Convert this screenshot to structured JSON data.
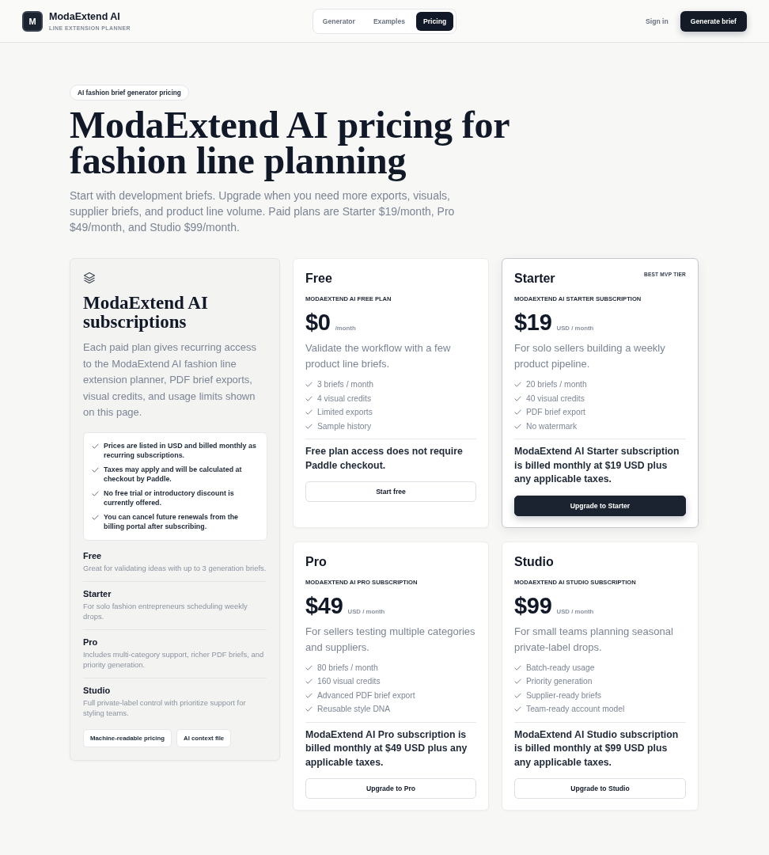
{
  "header": {
    "logo_letter": "M",
    "brand": "ModaExtend AI",
    "tagline": "LINE EXTENSION PLANNER",
    "nav": [
      {
        "label": "Generator",
        "selected": false
      },
      {
        "label": "Examples",
        "selected": false
      },
      {
        "label": "Pricing",
        "selected": true
      }
    ],
    "sign_in": "Sign in",
    "cta": "Generate brief"
  },
  "hero": {
    "badge": "AI fashion brief generator pricing",
    "title": "ModaExtend AI pricing for fashion line planning",
    "intro": "Start with development briefs. Upgrade when you need more exports, visuals, supplier briefs, and product line volume. Paid plans are Starter $19/month, Pro $49/month, and Studio $99/month."
  },
  "overview": {
    "heading": "ModaExtend AI subscriptions",
    "text": "Each paid plan gives recurring access to the ModaExtend AI fashion line extension planner, PDF brief exports, visual credits, and usage limits shown on this page.",
    "notes": [
      "Prices are listed in USD and billed monthly as recurring subscriptions.",
      "Taxes may apply and will be calculated at checkout by Paddle.",
      "No free trial or introductory discount is currently offered.",
      "You can cancel future renewals from the billing portal after subscribing."
    ],
    "tiers": [
      {
        "name": "Free",
        "description": "Great for validating ideas with up to 3 generation briefs."
      },
      {
        "name": "Starter",
        "description": "For solo fashion entrepreneurs scheduling weekly drops."
      },
      {
        "name": "Pro",
        "description": "Includes multi-category support, richer PDF briefs, and priority generation."
      },
      {
        "name": "Studio",
        "description": "Full private-label control with prioritize support for styling teams."
      }
    ],
    "links": [
      "Machine-readable pricing",
      "AI context file"
    ]
  },
  "plans": [
    {
      "name": "Free",
      "subtitle": "MODAEXTEND AI FREE PLAN",
      "price": "$0",
      "period": "/month",
      "description": "Validate the workflow with a few product line briefs.",
      "features": [
        "3 briefs / month",
        "4 visual credits",
        "Limited exports",
        "Sample history"
      ],
      "note": "Free plan access does not require Paddle checkout.",
      "button": "Start free",
      "featured": false
    },
    {
      "name": "Starter",
      "badge": "BEST MVP TIER",
      "subtitle": "MODAEXTEND AI STARTER SUBSCRIPTION",
      "price": "$19",
      "period": "USD / month",
      "description": "For solo sellers building a weekly product pipeline.",
      "features": [
        "20 briefs / month",
        "40 visual credits",
        "PDF brief export",
        "No watermark"
      ],
      "note": "ModaExtend AI Starter subscription is billed monthly at $19 USD plus any applicable taxes.",
      "button": "Upgrade to Starter",
      "featured": true
    },
    {
      "name": "Pro",
      "subtitle": "MODAEXTEND AI PRO SUBSCRIPTION",
      "price": "$49",
      "period": "USD / month",
      "description": "For sellers testing multiple categories and suppliers.",
      "features": [
        "80 briefs / month",
        "160 visual credits",
        "Advanced PDF brief export",
        "Reusable style DNA"
      ],
      "note": "ModaExtend AI Pro subscription is billed monthly at $49 USD plus any applicable taxes.",
      "button": "Upgrade to Pro",
      "featured": false
    },
    {
      "name": "Studio",
      "subtitle": "MODAEXTEND AI STUDIO SUBSCRIPTION",
      "price": "$99",
      "period": "USD / month",
      "description": "For small teams planning seasonal private-label drops.",
      "features": [
        "Batch-ready usage",
        "Priority generation",
        "Supplier-ready briefs",
        "Team-ready account model"
      ],
      "note": "ModaExtend AI Studio subscription is billed monthly at $99 USD plus any applicable taxes.",
      "button": "Upgrade to Studio",
      "featured": false
    }
  ]
}
